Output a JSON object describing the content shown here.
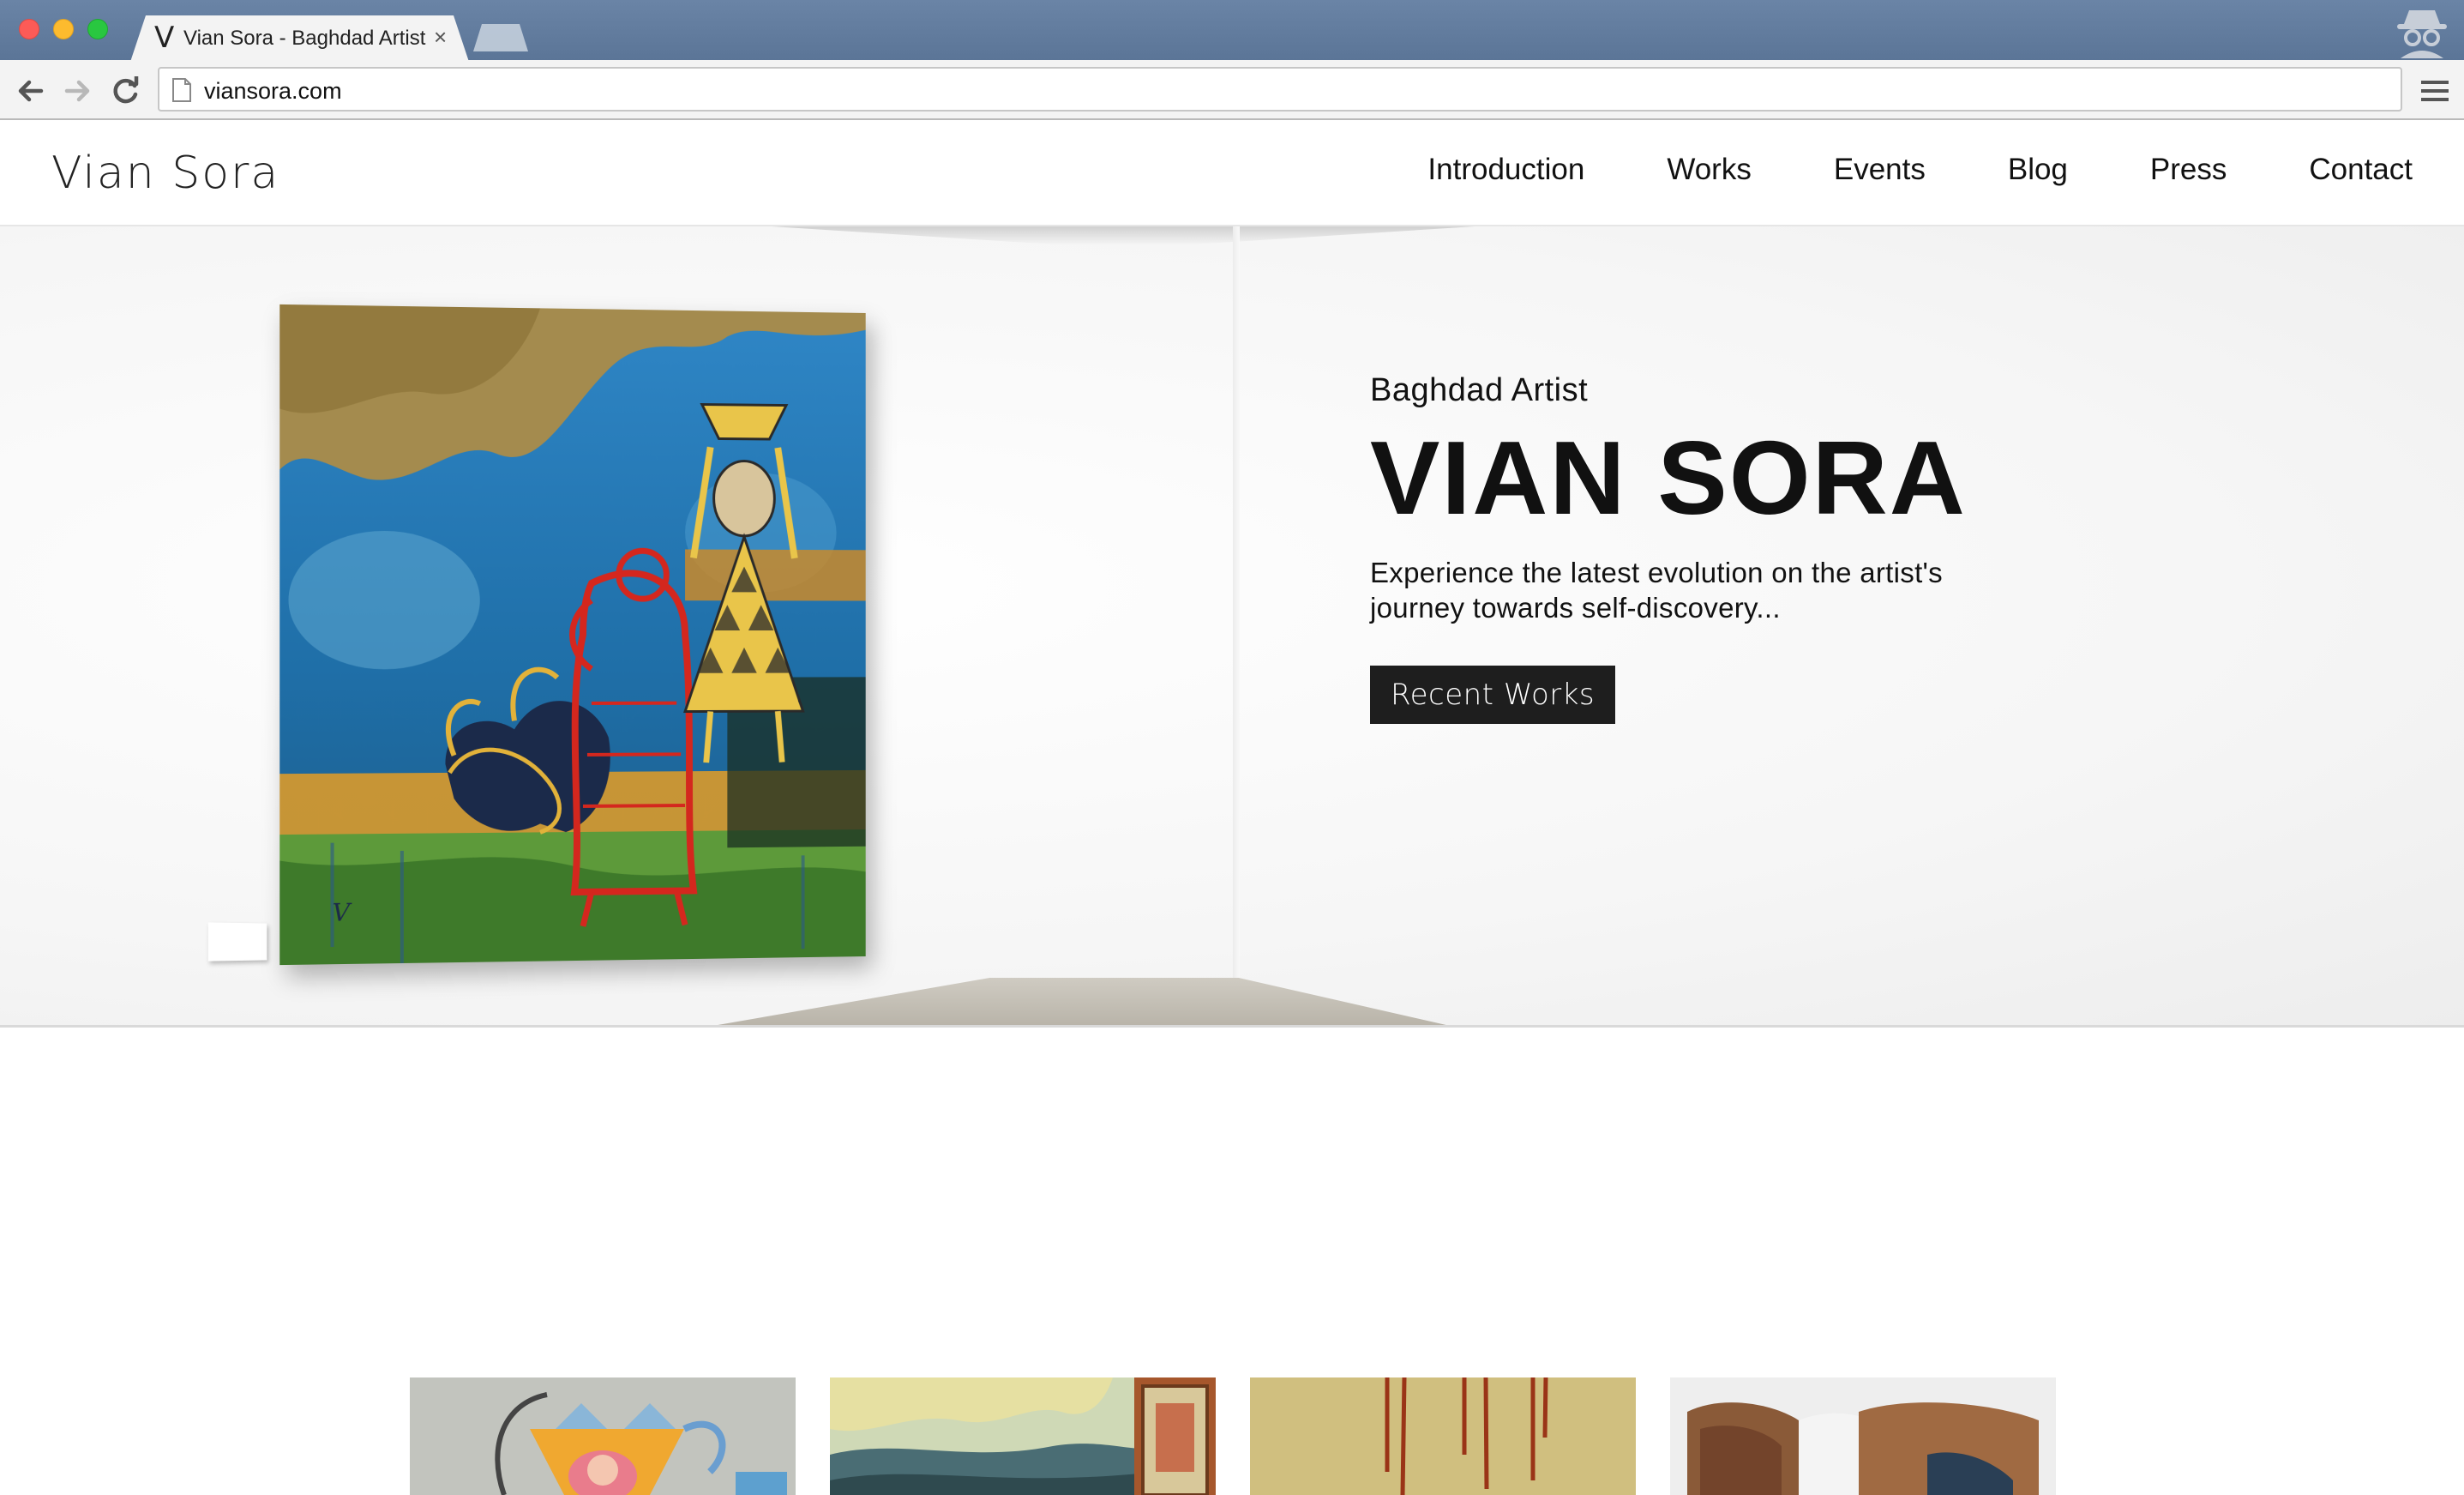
{
  "browser": {
    "tab": {
      "favicon": "V",
      "title": "Vian Sora - Baghdad Artist",
      "close": "×"
    },
    "address": {
      "url": "viansora.com"
    },
    "icons": [
      "back-arrow-icon",
      "forward-arrow-icon",
      "reload-icon",
      "page-icon",
      "hamburger-menu-icon",
      "incognito-icon"
    ]
  },
  "site": {
    "logo": "Vian Sora",
    "nav": [
      {
        "label": "Introduction"
      },
      {
        "label": "Works"
      },
      {
        "label": "Events"
      },
      {
        "label": "Blog"
      },
      {
        "label": "Press"
      },
      {
        "label": "Contact"
      }
    ]
  },
  "hero": {
    "kicker": "Baghdad Artist",
    "title": "VIAN SORA",
    "subtitle": "Experience the latest evolution on the artist's journey towards self-discovery...",
    "cta": "Recent Works"
  },
  "thumbnails": [
    {
      "name": "artwork-thumbnail-1"
    },
    {
      "name": "artwork-thumbnail-2"
    },
    {
      "name": "artwork-thumbnail-3"
    },
    {
      "name": "artwork-thumbnail-4"
    }
  ]
}
